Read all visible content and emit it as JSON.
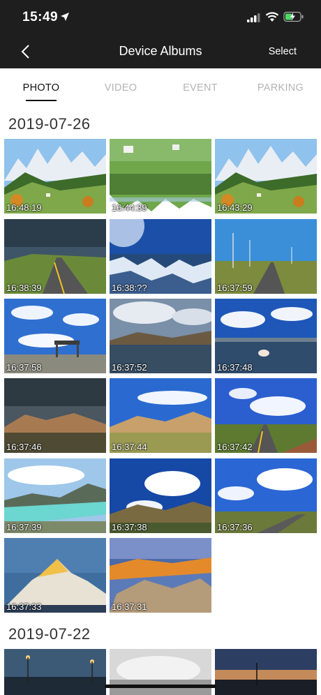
{
  "status_bar": {
    "time": "15:49"
  },
  "nav": {
    "title": "Device Albums",
    "select_label": "Select"
  },
  "tabs": [
    {
      "label": "PHOTO",
      "active": true
    },
    {
      "label": "VIDEO",
      "active": false
    },
    {
      "label": "EVENT",
      "active": false
    },
    {
      "label": "PARKING",
      "active": false
    }
  ],
  "groups": [
    {
      "date": "2019-07-26",
      "photos": [
        {
          "time": "16:48:19",
          "scene": "alpine-village"
        },
        {
          "time": "16:44:39",
          "scene": "village-reflection"
        },
        {
          "time": "16:43:29",
          "scene": "alpine-village"
        },
        {
          "time": "16:38:39",
          "scene": "mountain-road"
        },
        {
          "time": "16:38:??",
          "scene": "snowy-peaks"
        },
        {
          "time": "16:37:59",
          "scene": "wind-turbines"
        },
        {
          "time": "16:37:58",
          "scene": "road-gate"
        },
        {
          "time": "16:37:52",
          "scene": "lake-clouds"
        },
        {
          "time": "16:37:48",
          "scene": "lake-yak"
        },
        {
          "time": "16:37:46",
          "scene": "desert-hills"
        },
        {
          "time": "16:37:44",
          "scene": "sand-hills"
        },
        {
          "time": "16:37:42",
          "scene": "curved-road"
        },
        {
          "time": "16:37:39",
          "scene": "turquoise-lake"
        },
        {
          "time": "16:37:38",
          "scene": "cloud-valley"
        },
        {
          "time": "16:37:36",
          "scene": "open-road"
        },
        {
          "time": "16:37:33",
          "scene": "everest"
        },
        {
          "time": "16:37:31",
          "scene": "sunset-rocks"
        }
      ]
    },
    {
      "date": "2019-07-22",
      "photos": [
        {
          "scene": "night-street"
        },
        {
          "scene": "foggy-gray"
        },
        {
          "scene": "dusk-horizon"
        }
      ]
    }
  ],
  "colors": {
    "bar": "#1e1e1e",
    "tab_active": "#111111",
    "tab_inactive": "#b3b3b3"
  }
}
